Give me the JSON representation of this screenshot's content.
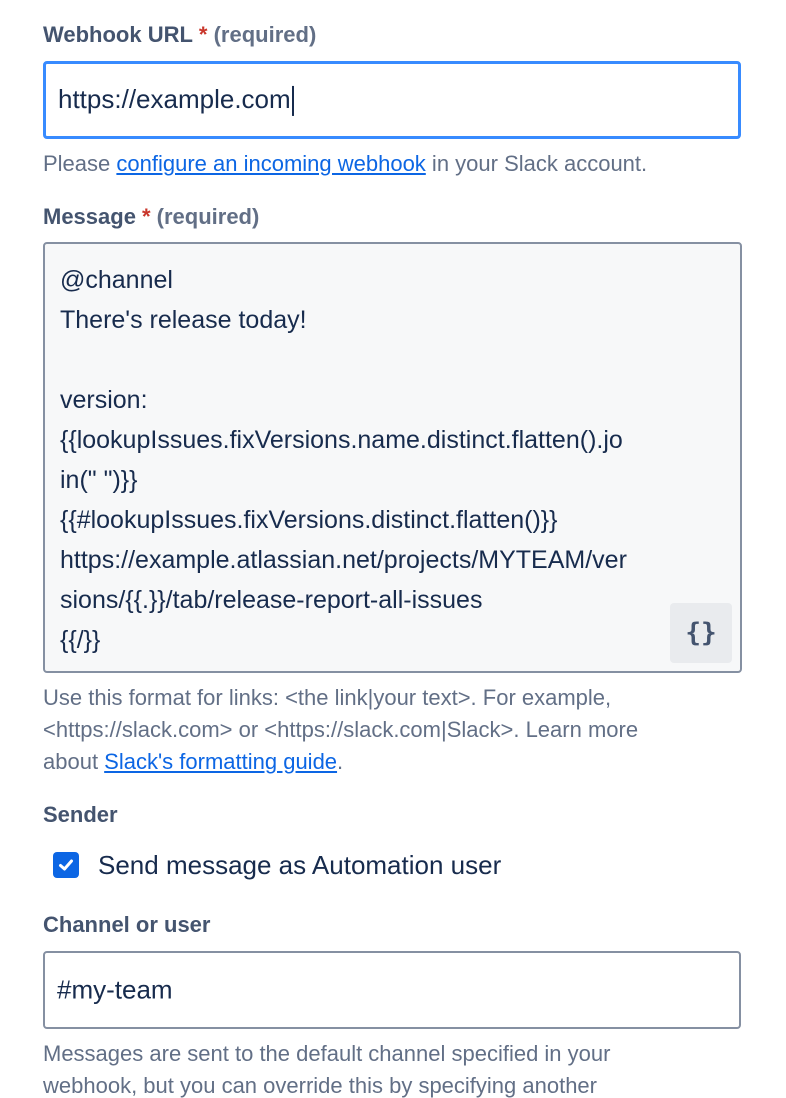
{
  "webhook": {
    "label": "Webhook URL",
    "required_star": "*",
    "required_text": "(required)",
    "value": "https://example.com",
    "help_prefix": "Please ",
    "help_link": "configure an incoming webhook",
    "help_suffix": " in your Slack account."
  },
  "message": {
    "label": "Message",
    "required_star": "*",
    "required_text": "(required)",
    "lines": [
      "@channel",
      "There's release today!",
      "",
      "version:",
      "{{lookupIssues.fixVersions.name.distinct.flatten().jo",
      "in(\" \")}}",
      "{{#lookupIssues.fixVersions.distinct.flatten()}}",
      "https://example.atlassian.net/projects/MYTEAM/ver",
      "sions/{{.}}/tab/release-report-all-issues",
      "{{/}}"
    ],
    "smart_values_button": "{}",
    "help_line1": "Use this format for links: <the link|your text>. For example,",
    "help_line2": "<https://slack.com> or <https://slack.com|Slack>. Learn more",
    "help_line3_prefix": "about ",
    "help_link": "Slack's formatting guide",
    "help_line3_suffix": "."
  },
  "sender": {
    "label": "Sender",
    "checkbox_label": "Send message as Automation user",
    "checked": true
  },
  "channel": {
    "label": "Channel or user",
    "value": "#my-team",
    "help_line1": "Messages are sent to the default channel specified in your",
    "help_line2": "webhook, but you can override this by specifying another"
  },
  "colors": {
    "accent": "#0c66e4",
    "focus_border": "#388bff",
    "required": "#c9372c"
  }
}
